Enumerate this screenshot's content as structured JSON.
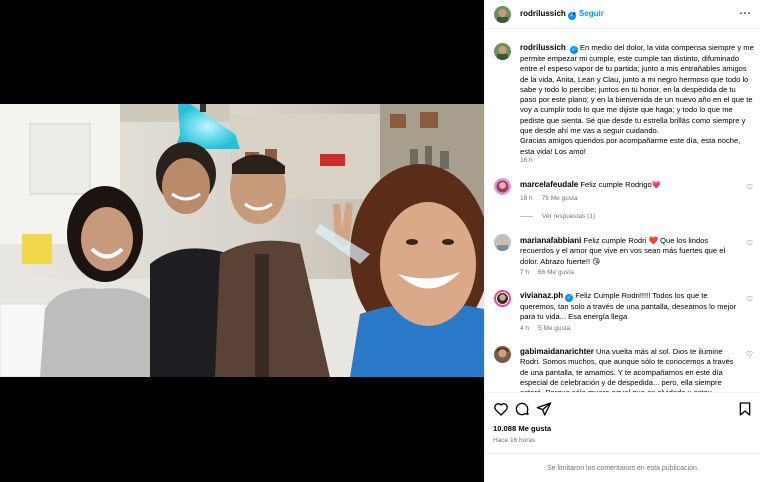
{
  "post": {
    "username": "rodrilussich",
    "follow_label": "Seguir",
    "separator": "•",
    "more_icon": "more-horizontal-icon",
    "caption": "En medio del dolor, la vida compensa siempre y me permite empezar mi cumple, este cumple tan distinto, difuminado entre el espeso vapor de tu partida; junto a mis entrañables amigos de la vida, Anita, Lean y Clau, junto a mi negro hermoso que todo lo sabe y todo lo percibe; juntos en tu honor, en la despedida de tu paso por este plano; y en la bienvenida de un nuevo año en el que te voy a cumplir todo lo que me dijiste que haga; y todo lo que me pediste que sienta. Sé que desde tu estrella brillás como siempre y que desde ahí me vas a seguir cuidando.",
    "caption_2": "Gracias amigos queridos por acompañarme este día, esta noche, esta vida! Los amo!",
    "caption_time": "16 h"
  },
  "comments": [
    {
      "user": "marcelafeudale",
      "text": "Feliz cumple Rodrigo",
      "emoji": "💗",
      "time": "16 h",
      "likes": "75 Me gusta",
      "replies": "Ver respuestas (1)"
    },
    {
      "user": "marianafabbiani",
      "text": "Feliz cumple Rodri",
      "emoji": "❤️",
      "text_2": "Que los lindos recuerdos y el amor que vive en vos sean más fuertes que el dolor. Abrazo fuerte!!",
      "emoji_2": "😘",
      "time": "7 h",
      "likes": "66 Me gusta"
    },
    {
      "user": "vivianaz.ph",
      "text": "Feliz Cumple Rodri!!!!! Todos los que te queremos, tan solo a través de una pantalla, deseamos lo mejor para tu vida... Esa energía llega",
      "time": "4 h",
      "likes": "5 Me gusta"
    },
    {
      "user": "gabimaidanarichter",
      "text": "Una vuelta más al sol. Dios te ilumine Rodri. Somos muchos, que aunque sólo te conocemos a través de una pantalla, te amamos. Y te acompañamos en este día especial de celebración y de despedida... pero, ella siempre estará. Porque sólo muere aquel que es olvidado y estoy"
    }
  ],
  "actions": {
    "likes": "10.088 Me gusta",
    "time": "Hace 16 horas",
    "comments_limited": "Se limitaron los comentarios en esta publicación.",
    "icons": [
      "heart-icon",
      "comment-icon",
      "share-icon",
      "bookmark-icon"
    ]
  },
  "colors": {
    "accent": "#0095f6",
    "muted": "#737373",
    "border": "#efefef"
  }
}
